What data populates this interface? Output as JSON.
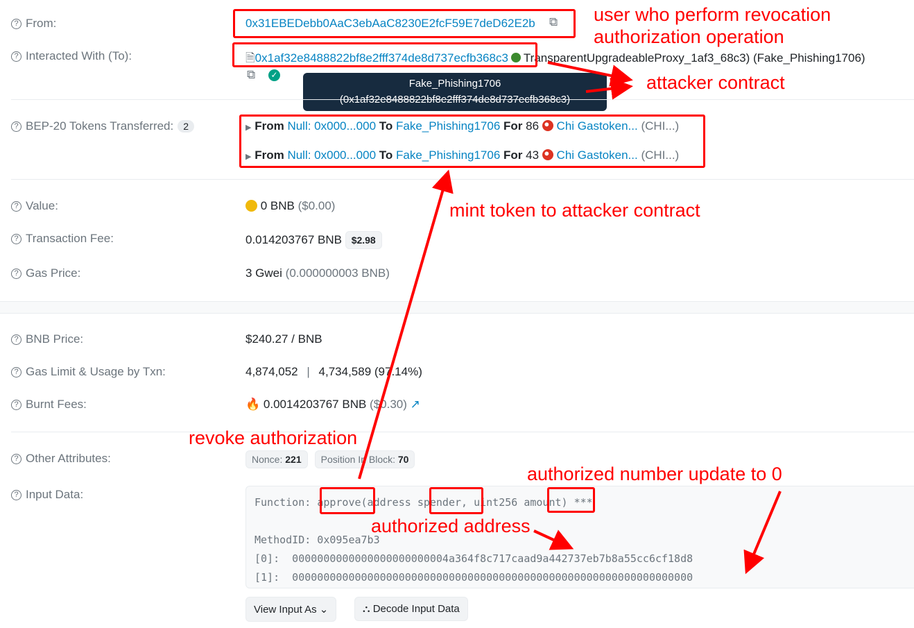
{
  "rows": {
    "from": {
      "label": "From:",
      "value": "0x31EBEDebb0AaC3ebAaC8230E2fcF59E7deD62E2b"
    },
    "to": {
      "label": "Interacted With (To):",
      "address": "0x1af32e8488822bf8e2fff374de8d737ecfb368c3",
      "name": "TransparentUpgradeableProxy_1af3_68c3) (Fake_Phishing1706)"
    },
    "tooltip": {
      "line1": "Fake_Phishing1706",
      "line2": "(0x1af32e8488822bf8e2fff374de8d737ecfb368c3)"
    },
    "tokens": {
      "label": "BEP-20 Tokens Transferred:",
      "count": "2",
      "items": [
        {
          "from": "From",
          "from_name": "Null: 0x000...000",
          "to": "To",
          "to_name": "Fake_Phishing1706",
          "for": "For",
          "amount": "86",
          "token": "Chi Gastoken...",
          "symbol": "(CHI...)"
        },
        {
          "from": "From",
          "from_name": "Null: 0x000...000",
          "to": "To",
          "to_name": "Fake_Phishing1706",
          "for": "For",
          "amount": "43",
          "token": "Chi Gastoken...",
          "symbol": "(CHI...)"
        }
      ]
    },
    "value": {
      "label": "Value:",
      "amount": "0 BNB",
      "usd": "($0.00)"
    },
    "fee": {
      "label": "Transaction Fee:",
      "amount": "0.014203767 BNB",
      "usd": "$2.98"
    },
    "gas_price": {
      "label": "Gas Price:",
      "amount": "3 Gwei",
      "bnb": "(0.000000003 BNB)"
    },
    "bnb_price": {
      "label": "BNB Price:",
      "value": "$240.27 / BNB"
    },
    "gas_limit": {
      "label": "Gas Limit & Usage by Txn:",
      "limit": "4,874,052",
      "sep": "|",
      "usage": "4,734,589 (97.14%)"
    },
    "burnt": {
      "label": "Burnt Fees:",
      "value": "0.0014203767 BNB",
      "usd": "($0.30)"
    },
    "other": {
      "label": "Other Attributes:",
      "nonce_label": "Nonce:",
      "nonce": "221",
      "pos_label": "Position In Block:",
      "pos": "70"
    },
    "input": {
      "label": "Input Data:",
      "function_prefix": "Function: ",
      "fn": "approve",
      "p1": "(address ",
      "spender": "spender",
      "p2": ", uint256 ",
      "amount": "amount",
      "p3": ") ***",
      "method": "MethodID: 0x095ea7b3",
      "arg0": "[0]:  0000000000000000000000004a364f8c717caad9a442737eb7b8a55cc6cf18d8",
      "arg1": "[1]:  0000000000000000000000000000000000000000000000000000000000000000",
      "view_btn": "View Input As",
      "decode_btn": "Decode Input Data"
    }
  },
  "annotations": {
    "user": "user who perform revocation",
    "user2": "authorization operation",
    "attacker": "attacker contract",
    "mint": "mint token to attacker contract",
    "revoke": "revoke authorization",
    "number": "authorized number update to 0",
    "address": "authorized address"
  },
  "colors": {
    "link": "#0784c3",
    "annotation": "#ff0000",
    "tooltip": "#172b3f"
  }
}
